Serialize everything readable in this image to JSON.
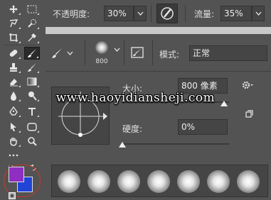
{
  "options_bar": {
    "opacity_label": "不透明度:",
    "opacity_value": "30%",
    "flow_label": "流量:",
    "flow_value": "35%",
    "pressure_icon": "pen-pressure-icon"
  },
  "brush_panel": {
    "brush_size_number": "800",
    "mode_label": "模式:",
    "mode_value": "正常",
    "size_label": "大小:",
    "size_value": "800 像素",
    "hardness_label": "硬度:",
    "hardness_value": "0%",
    "size_slider_fraction": 0.95,
    "hardness_slider_fraction": 0.0,
    "preset_count": 7
  },
  "tools": [
    "move-tool-icon",
    "marquee-tool-icon",
    "lasso-tool-icon",
    "quick-select-tool-icon",
    "crop-tool-icon",
    "eyedropper-tool-icon",
    "healing-brush-tool-icon",
    "brush-tool-icon",
    "clone-stamp-tool-icon",
    "history-brush-tool-icon",
    "eraser-tool-icon",
    "gradient-tool-icon",
    "blur-tool-icon",
    "dodge-tool-icon",
    "pen-tool-icon",
    "type-tool-icon",
    "path-select-tool-icon",
    "shape-tool-icon",
    "hand-tool-icon",
    "zoom-tool-icon"
  ],
  "colors": {
    "foreground": "#8e2fc1",
    "background": "#1f44d6",
    "panel_bg": "#535353",
    "field_bg": "#454545",
    "highlight_circle": "#c0392b"
  },
  "watermark": "www.haoyidianshejі.com"
}
